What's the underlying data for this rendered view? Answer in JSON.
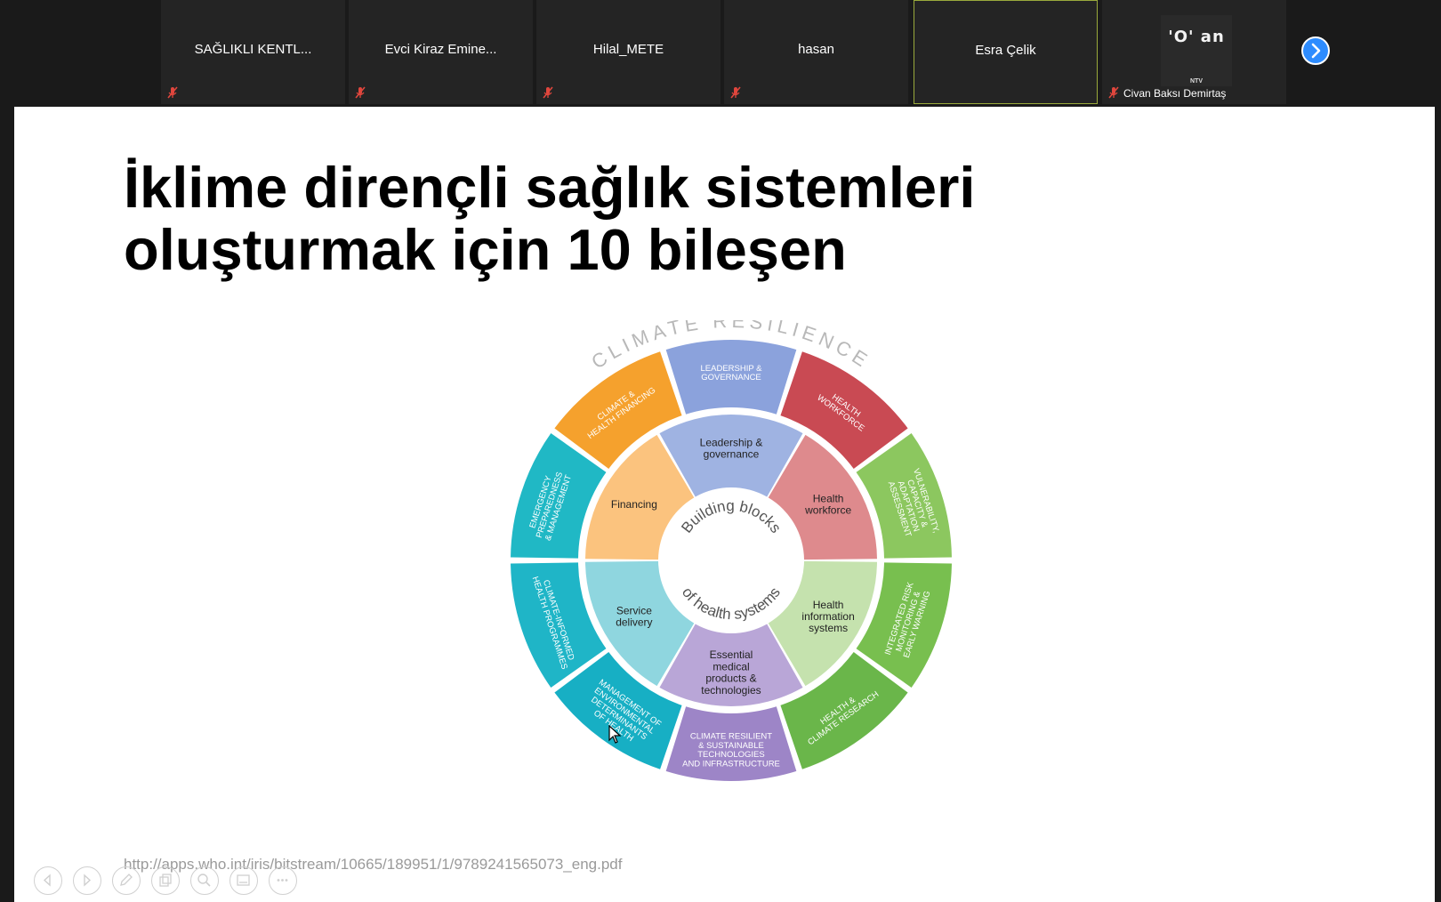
{
  "meeting": {
    "participants": [
      {
        "name": "SAĞLIKLI KENTL..."
      },
      {
        "name": "Evci Kiraz Emine..."
      },
      {
        "name": "Hilal_METE"
      },
      {
        "name": "hasan"
      },
      {
        "name": "Esra Çelik"
      },
      {
        "name": "Civan Baksı Demirtaş",
        "thumb_text": "'O' an",
        "thumb_sub": "NTV"
      }
    ],
    "icons": {
      "mic": "microphone-muted-icon",
      "next": "chevron-right-icon",
      "tools": [
        "previous-slide-icon",
        "next-slide-icon",
        "pen-icon",
        "copy-icon",
        "zoom-icon",
        "subtitles-icon",
        "more-icon"
      ]
    },
    "colors": {
      "accent": "#2d8cff",
      "muted": "#e0463d",
      "active_speaker": "#9aaa3c"
    }
  },
  "slide": {
    "title_line1": "İklime dirençli sağlık sistemleri",
    "title_line2": "oluşturmak için 10 bileşen",
    "url": "http://apps.who.int/iris/bitstream/10665/189951/1/9789241565073_eng.pdf",
    "diagram": {
      "arc_title": "CLIMATE RESILIENCE",
      "center_top": "Building blocks",
      "center_bottom": "of health systems",
      "inner": [
        {
          "lines": [
            "Leadership &",
            "governance"
          ],
          "color": "#9fb3e2"
        },
        {
          "lines": [
            "Health",
            "workforce"
          ],
          "color": "#de8a8d"
        },
        {
          "lines": [
            "Health",
            "information",
            "systems"
          ],
          "color": "#c5e2ae"
        },
        {
          "lines": [
            "Essential",
            "medical",
            "products &",
            "technologies"
          ],
          "color": "#b9a6d7"
        },
        {
          "lines": [
            "Service",
            "delivery"
          ],
          "color": "#8fd6df"
        },
        {
          "lines": [
            "Financing"
          ],
          "color": "#fbc37e"
        }
      ],
      "outer": [
        {
          "lines": [
            "LEADERSHIP &",
            "GOVERNANCE"
          ],
          "color": "#8ba2dc"
        },
        {
          "lines": [
            "HEALTH",
            "WORKFORCE"
          ],
          "color": "#c94a53"
        },
        {
          "lines": [
            "VULNERABILITY,",
            "CAPACITY &",
            "ADAPTATION",
            "ASSESSMENT"
          ],
          "color": "#8cc75f"
        },
        {
          "lines": [
            "INTEGRATED RISK",
            "MONITORING &",
            "EARLY WARNING"
          ],
          "color": "#78bf4f"
        },
        {
          "lines": [
            "HEALTH &",
            "CLIMATE RESEARCH"
          ],
          "color": "#6ab64a"
        },
        {
          "lines": [
            "CLIMATE RESILIENT",
            "& SUSTAINABLE",
            "TECHNOLOGIES",
            "AND INFRASTRUCTURE"
          ],
          "color": "#9d85c7"
        },
        {
          "lines": [
            "MANAGEMENT OF",
            "ENVIRONMENTAL",
            "DETERMINANTS",
            "OF HEALTH"
          ],
          "color": "#17afc4"
        },
        {
          "lines": [
            "CLIMATE-INFORMED",
            "HEALTH PROGRAMMES"
          ],
          "color": "#1fb5c7"
        },
        {
          "lines": [
            "EMERGENCY",
            "PREPAREDNESS",
            "& MANAGEMENT"
          ],
          "color": "#20b8c5"
        },
        {
          "lines": [
            "CLIMATE &",
            "HEALTH FINANCING"
          ],
          "color": "#f5a12d"
        }
      ]
    }
  }
}
